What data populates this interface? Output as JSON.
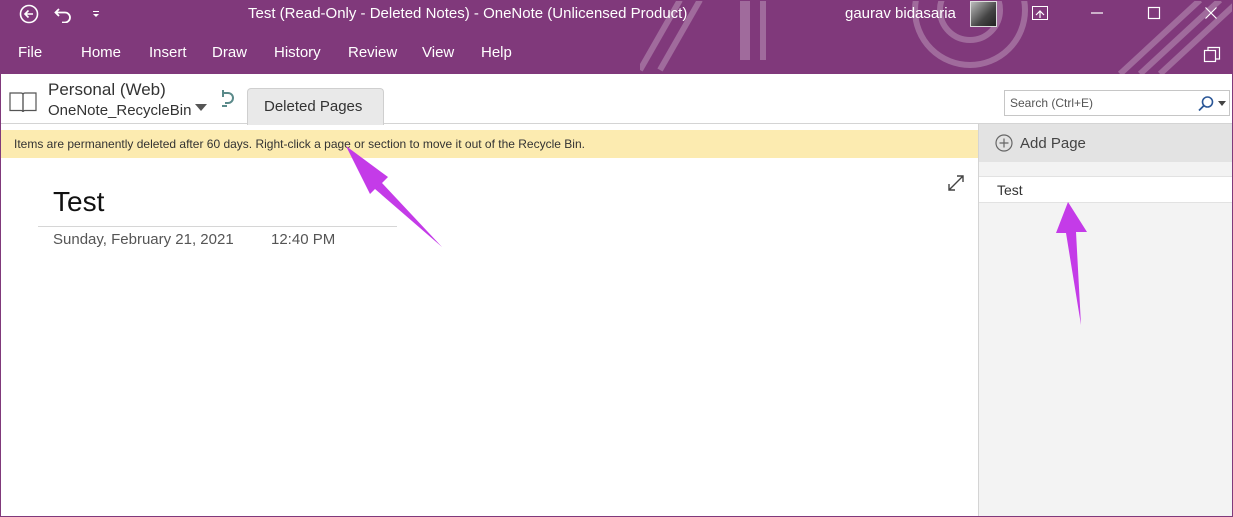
{
  "titlebar": {
    "title": "Test (Read-Only - Deleted Notes)  -  OneNote (Unlicensed Product)",
    "user_name": "gaurav bidasaria"
  },
  "ribbon": {
    "tabs": [
      "File",
      "Home",
      "Insert",
      "Draw",
      "History",
      "Review",
      "View",
      "Help"
    ]
  },
  "notebook": {
    "name": "Personal (Web)",
    "section_group": "OneNote_RecycleBin",
    "section_tab": "Deleted Pages"
  },
  "search": {
    "placeholder": "Search (Ctrl+E)"
  },
  "infobar": {
    "message": "Items are permanently deleted after 60 days. Right-click a page or section to move it out of the Recycle Bin."
  },
  "page": {
    "title": "Test",
    "date": "Sunday, February 21, 2021",
    "time": "12:40 PM"
  },
  "pagelist": {
    "add_label": "Add Page",
    "items": [
      "Test"
    ]
  },
  "colors": {
    "brand": "#80397b",
    "infobar": "#fcebb0",
    "annotation_arrow": "#c43be8"
  },
  "icons": [
    "back-icon",
    "undo-icon",
    "customize-qat-icon",
    "ribbon-display-icon",
    "minimize-icon",
    "maximize-icon",
    "close-icon",
    "notebook-icon",
    "dropdown-icon",
    "sync-icon",
    "search-icon",
    "expand-icon",
    "add-page-icon",
    "switch-window-icon"
  ]
}
